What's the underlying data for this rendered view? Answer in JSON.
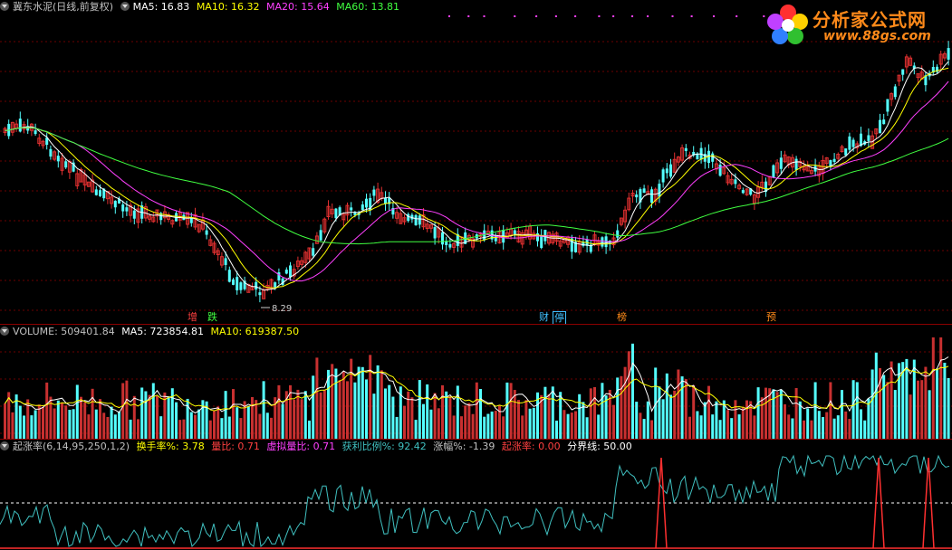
{
  "price_panel": {
    "legend": {
      "title": "冀东水泥(日线,前复权)",
      "ma5": "MA5: 16.83",
      "ma10": "MA10: 16.32",
      "ma20": "MA20: 15.64",
      "ma60": "MA60: 13.81"
    },
    "low_label": "8.29",
    "markers": [
      {
        "text": "增",
        "color": "#ff4040"
      },
      {
        "text": "跌",
        "color": "#40ff40"
      },
      {
        "text": "财",
        "color": "#40c0ff"
      },
      {
        "text": "停",
        "color": "#40c0ff"
      },
      {
        "text": "榜",
        "color": "#ff8a1a"
      },
      {
        "text": "预",
        "color": "#ff8a1a"
      }
    ],
    "colors": {
      "up": "#e03030",
      "down": "#54ffff",
      "ma5": "#ffffff",
      "ma10": "#ffff00",
      "ma20": "#ff40ff",
      "ma60": "#40ff40"
    }
  },
  "logo": {
    "title": "分析家公式网",
    "url": "www.88gs.com"
  },
  "volume_panel": {
    "legend": {
      "title": "VOLUME: 509401.84",
      "ma5": "MA5: 723854.81",
      "ma10": "MA10: 619387.50"
    }
  },
  "indicator_panel": {
    "legend": {
      "title": "起涨率(6,14,95,250,1,2)",
      "turnover": "换手率%: 3.78",
      "volume_ratio": "量比: 0.71",
      "virtual_ratio": "虚拟量比: 0.71",
      "profit_ratio": "获利比例%: 92.42",
      "change": "涨幅%: -1.39",
      "rise_rate": "起涨率: 0.00",
      "divider": "分界线: 50.00"
    }
  }
}
